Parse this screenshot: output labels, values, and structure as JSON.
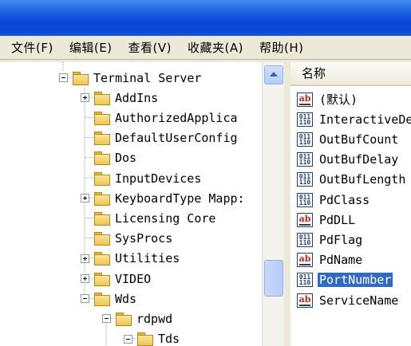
{
  "menu": [
    "文件(F)",
    "编辑(E)",
    "查看(V)",
    "收藏夹(A)",
    "帮助(H)"
  ],
  "tree": [
    {
      "label": "Terminal Server",
      "level": 0,
      "expander": "minus"
    },
    {
      "label": "AddIns",
      "level": 1,
      "expander": "plus"
    },
    {
      "label": "AuthorizedApplica",
      "level": 1,
      "expander": ""
    },
    {
      "label": "DefaultUserConfig",
      "level": 1,
      "expander": ""
    },
    {
      "label": "Dos",
      "level": 1,
      "expander": ""
    },
    {
      "label": "InputDevices",
      "level": 1,
      "expander": ""
    },
    {
      "label": "KeyboardType Mapp:",
      "level": 1,
      "expander": "plus"
    },
    {
      "label": "Licensing Core",
      "level": 1,
      "expander": ""
    },
    {
      "label": "SysProcs",
      "level": 1,
      "expander": ""
    },
    {
      "label": "Utilities",
      "level": 1,
      "expander": "plus"
    },
    {
      "label": "VIDEO",
      "level": 1,
      "expander": "plus"
    },
    {
      "label": "Wds",
      "level": 1,
      "expander": "minus"
    },
    {
      "label": "rdpwd",
      "level": 2,
      "expander": "minus"
    },
    {
      "label": "Tds",
      "level": 3,
      "expander": "minus"
    }
  ],
  "list_header": "名称",
  "values": [
    {
      "name": "(默认)",
      "type": "string"
    },
    {
      "name": "InteractiveDe",
      "type": "binary"
    },
    {
      "name": "OutBufCount",
      "type": "binary"
    },
    {
      "name": "OutBufDelay",
      "type": "binary"
    },
    {
      "name": "OutBufLength",
      "type": "binary"
    },
    {
      "name": "PdClass",
      "type": "binary"
    },
    {
      "name": "PdDLL",
      "type": "string"
    },
    {
      "name": "PdFlag",
      "type": "binary"
    },
    {
      "name": "PdName",
      "type": "string"
    },
    {
      "name": "PortNumber",
      "type": "binary",
      "selected": true
    },
    {
      "name": "ServiceName",
      "type": "string"
    }
  ]
}
